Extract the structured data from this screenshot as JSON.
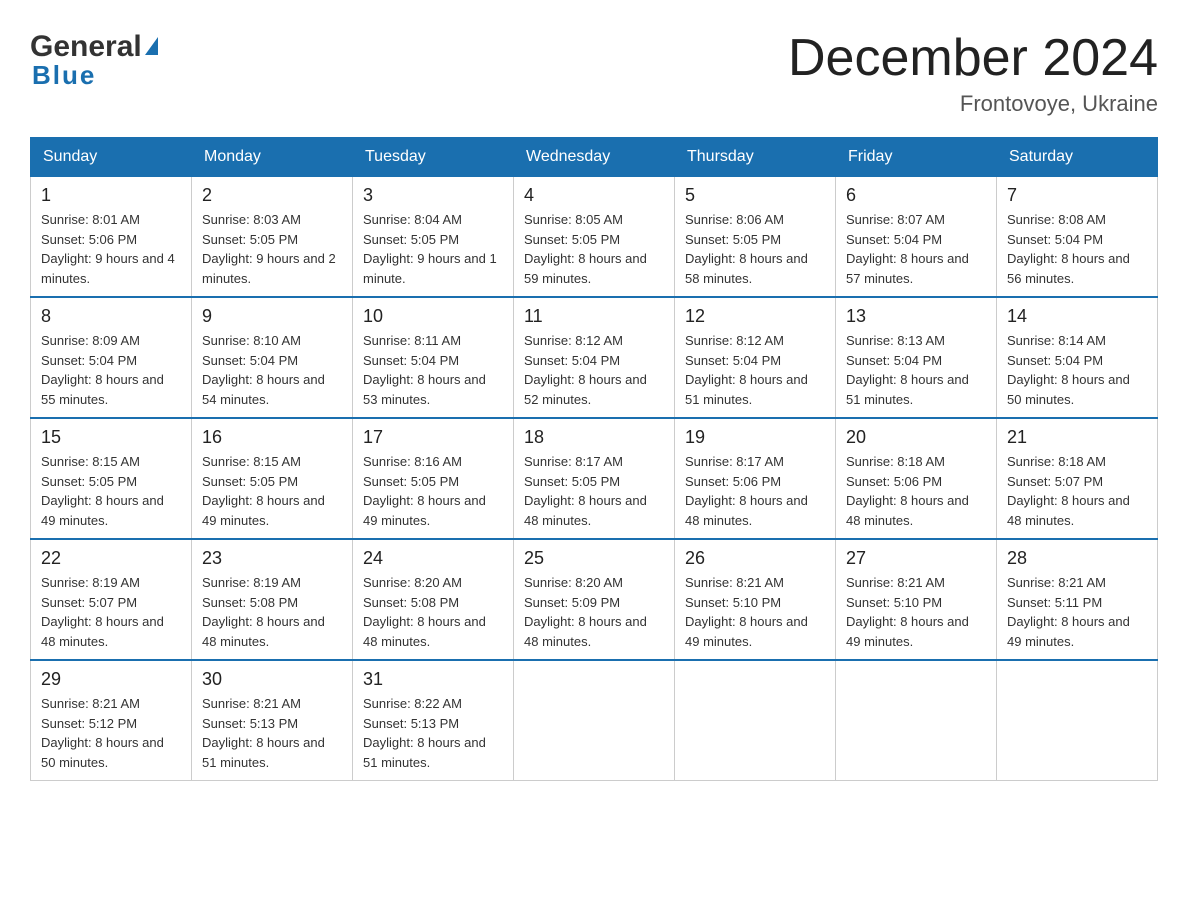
{
  "header": {
    "logo_general": "General",
    "logo_blue": "Blue",
    "month_title": "December 2024",
    "location": "Frontovoye, Ukraine"
  },
  "days_of_week": [
    "Sunday",
    "Monday",
    "Tuesday",
    "Wednesday",
    "Thursday",
    "Friday",
    "Saturday"
  ],
  "weeks": [
    [
      {
        "day": "1",
        "sunrise": "8:01 AM",
        "sunset": "5:06 PM",
        "daylight": "9 hours and 4 minutes."
      },
      {
        "day": "2",
        "sunrise": "8:03 AM",
        "sunset": "5:05 PM",
        "daylight": "9 hours and 2 minutes."
      },
      {
        "day": "3",
        "sunrise": "8:04 AM",
        "sunset": "5:05 PM",
        "daylight": "9 hours and 1 minute."
      },
      {
        "day": "4",
        "sunrise": "8:05 AM",
        "sunset": "5:05 PM",
        "daylight": "8 hours and 59 minutes."
      },
      {
        "day": "5",
        "sunrise": "8:06 AM",
        "sunset": "5:05 PM",
        "daylight": "8 hours and 58 minutes."
      },
      {
        "day": "6",
        "sunrise": "8:07 AM",
        "sunset": "5:04 PM",
        "daylight": "8 hours and 57 minutes."
      },
      {
        "day": "7",
        "sunrise": "8:08 AM",
        "sunset": "5:04 PM",
        "daylight": "8 hours and 56 minutes."
      }
    ],
    [
      {
        "day": "8",
        "sunrise": "8:09 AM",
        "sunset": "5:04 PM",
        "daylight": "8 hours and 55 minutes."
      },
      {
        "day": "9",
        "sunrise": "8:10 AM",
        "sunset": "5:04 PM",
        "daylight": "8 hours and 54 minutes."
      },
      {
        "day": "10",
        "sunrise": "8:11 AM",
        "sunset": "5:04 PM",
        "daylight": "8 hours and 53 minutes."
      },
      {
        "day": "11",
        "sunrise": "8:12 AM",
        "sunset": "5:04 PM",
        "daylight": "8 hours and 52 minutes."
      },
      {
        "day": "12",
        "sunrise": "8:12 AM",
        "sunset": "5:04 PM",
        "daylight": "8 hours and 51 minutes."
      },
      {
        "day": "13",
        "sunrise": "8:13 AM",
        "sunset": "5:04 PM",
        "daylight": "8 hours and 51 minutes."
      },
      {
        "day": "14",
        "sunrise": "8:14 AM",
        "sunset": "5:04 PM",
        "daylight": "8 hours and 50 minutes."
      }
    ],
    [
      {
        "day": "15",
        "sunrise": "8:15 AM",
        "sunset": "5:05 PM",
        "daylight": "8 hours and 49 minutes."
      },
      {
        "day": "16",
        "sunrise": "8:15 AM",
        "sunset": "5:05 PM",
        "daylight": "8 hours and 49 minutes."
      },
      {
        "day": "17",
        "sunrise": "8:16 AM",
        "sunset": "5:05 PM",
        "daylight": "8 hours and 49 minutes."
      },
      {
        "day": "18",
        "sunrise": "8:17 AM",
        "sunset": "5:05 PM",
        "daylight": "8 hours and 48 minutes."
      },
      {
        "day": "19",
        "sunrise": "8:17 AM",
        "sunset": "5:06 PM",
        "daylight": "8 hours and 48 minutes."
      },
      {
        "day": "20",
        "sunrise": "8:18 AM",
        "sunset": "5:06 PM",
        "daylight": "8 hours and 48 minutes."
      },
      {
        "day": "21",
        "sunrise": "8:18 AM",
        "sunset": "5:07 PM",
        "daylight": "8 hours and 48 minutes."
      }
    ],
    [
      {
        "day": "22",
        "sunrise": "8:19 AM",
        "sunset": "5:07 PM",
        "daylight": "8 hours and 48 minutes."
      },
      {
        "day": "23",
        "sunrise": "8:19 AM",
        "sunset": "5:08 PM",
        "daylight": "8 hours and 48 minutes."
      },
      {
        "day": "24",
        "sunrise": "8:20 AM",
        "sunset": "5:08 PM",
        "daylight": "8 hours and 48 minutes."
      },
      {
        "day": "25",
        "sunrise": "8:20 AM",
        "sunset": "5:09 PM",
        "daylight": "8 hours and 48 minutes."
      },
      {
        "day": "26",
        "sunrise": "8:21 AM",
        "sunset": "5:10 PM",
        "daylight": "8 hours and 49 minutes."
      },
      {
        "day": "27",
        "sunrise": "8:21 AM",
        "sunset": "5:10 PM",
        "daylight": "8 hours and 49 minutes."
      },
      {
        "day": "28",
        "sunrise": "8:21 AM",
        "sunset": "5:11 PM",
        "daylight": "8 hours and 49 minutes."
      }
    ],
    [
      {
        "day": "29",
        "sunrise": "8:21 AM",
        "sunset": "5:12 PM",
        "daylight": "8 hours and 50 minutes."
      },
      {
        "day": "30",
        "sunrise": "8:21 AM",
        "sunset": "5:13 PM",
        "daylight": "8 hours and 51 minutes."
      },
      {
        "day": "31",
        "sunrise": "8:22 AM",
        "sunset": "5:13 PM",
        "daylight": "8 hours and 51 minutes."
      },
      null,
      null,
      null,
      null
    ]
  ]
}
